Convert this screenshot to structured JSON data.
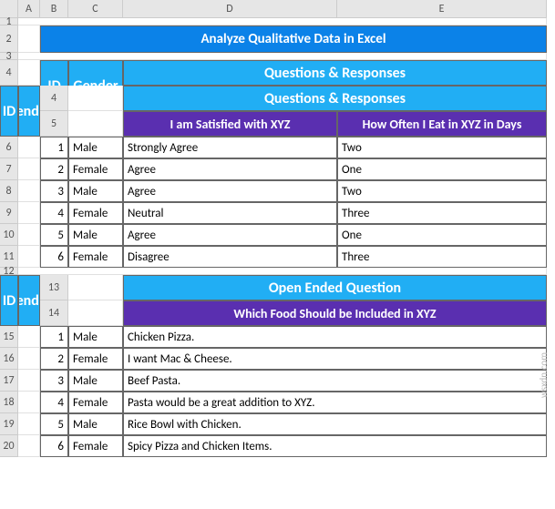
{
  "columns": [
    "",
    "A",
    "B",
    "C",
    "D",
    "E"
  ],
  "rows": [
    "1",
    "2",
    "3",
    "4",
    "5",
    "6",
    "7",
    "8",
    "9",
    "10",
    "11",
    "12",
    "13",
    "14",
    "15",
    "16",
    "17",
    "18",
    "19",
    "20"
  ],
  "main_title": "Analyze Qualitative Data in Excel",
  "t1": {
    "id_hdr": "ID",
    "gender_hdr": "Gender",
    "qr_hdr": "Questions & Responses",
    "col_d": "I am Satisfied with XYZ",
    "col_e": "How Often I Eat in XYZ in Days",
    "rows": [
      {
        "id": "1",
        "g": "Male",
        "d": "Strongly Agree",
        "e": "Two"
      },
      {
        "id": "2",
        "g": "Female",
        "d": "Agree",
        "e": "One"
      },
      {
        "id": "3",
        "g": "Male",
        "d": "Agree",
        "e": "Two"
      },
      {
        "id": "4",
        "g": "Female",
        "d": "Neutral",
        "e": "Three"
      },
      {
        "id": "5",
        "g": "Male",
        "d": "Agree",
        "e": "One"
      },
      {
        "id": "6",
        "g": "Female",
        "d": "Disagree",
        "e": "Three"
      }
    ]
  },
  "t2": {
    "id_hdr": "ID",
    "gender_hdr": "Gender",
    "open_hdr": "Open Ended Question",
    "col_de": "Which Food Should be Included in XYZ",
    "rows": [
      {
        "id": "1",
        "g": "Male",
        "de": "Chicken Pizza."
      },
      {
        "id": "2",
        "g": "Female",
        "de": "I want Mac & Cheese."
      },
      {
        "id": "3",
        "g": "Male",
        "de": "Beef Pasta."
      },
      {
        "id": "4",
        "g": "Female",
        "de": "Pasta would be a great addition to XYZ."
      },
      {
        "id": "5",
        "g": "Male",
        "de": "Rice Bowl with Chicken."
      },
      {
        "id": "6",
        "g": "Female",
        "de": "Spicy Pizza and Chicken Items."
      }
    ]
  },
  "watermark": "wsxdn.com"
}
